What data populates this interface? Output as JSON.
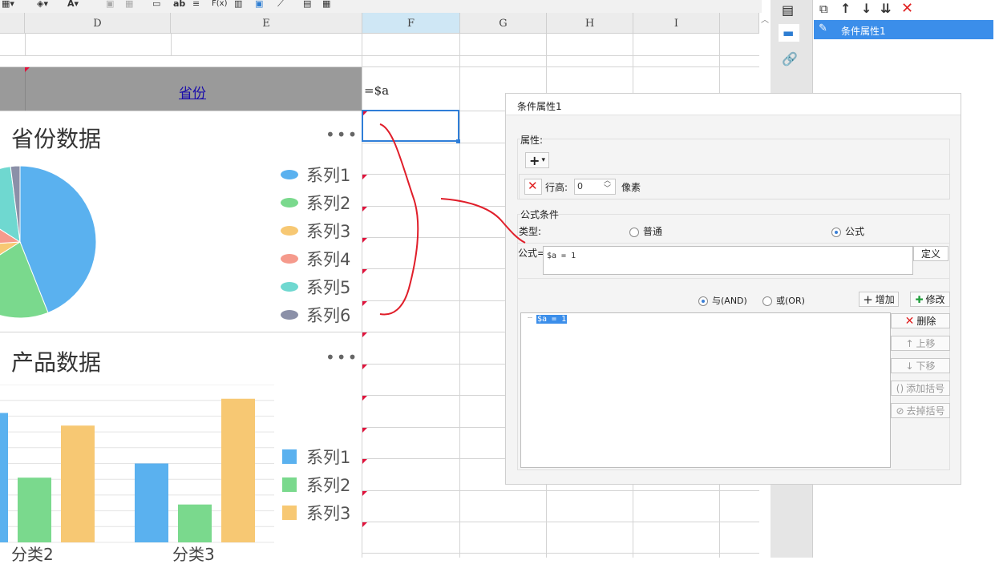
{
  "toolbar": {
    "text_style": "ab",
    "formula": "F(x)"
  },
  "columns": {
    "d": "D",
    "e": "E",
    "f": "F",
    "g": "G",
    "h": "H",
    "i": "I"
  },
  "cells": {
    "header_province": "省份",
    "formula_cell": "=$a"
  },
  "chart1": {
    "title": "省份数据",
    "more": "•••",
    "legend": [
      {
        "name": "系列1",
        "color": "#5ab1ef"
      },
      {
        "name": "系列2",
        "color": "#7ad98d"
      },
      {
        "name": "系列3",
        "color": "#f7c873"
      },
      {
        "name": "系列4",
        "color": "#f59a8c"
      },
      {
        "name": "系列5",
        "color": "#6fd8d0"
      },
      {
        "name": "系列6",
        "color": "#8b90a8"
      }
    ]
  },
  "chart2": {
    "title": "产品数据",
    "more": "•••",
    "axis_labels": [
      "分类2",
      "分类3"
    ],
    "legend": [
      {
        "name": "系列1",
        "color": "#5ab1ef"
      },
      {
        "name": "系列2",
        "color": "#7ad98d"
      },
      {
        "name": "系列3",
        "color": "#f7c873"
      }
    ]
  },
  "chart_data": [
    {
      "type": "pie",
      "title": "省份数据",
      "series": [
        {
          "name": "系列1",
          "value": 44
        },
        {
          "name": "系列2",
          "value": 22
        },
        {
          "name": "系列3",
          "value": 8
        },
        {
          "name": "系列4",
          "value": 10
        },
        {
          "name": "系列5",
          "value": 14
        },
        {
          "name": "系列6",
          "value": 2
        }
      ]
    },
    {
      "type": "bar",
      "title": "产品数据",
      "categories": [
        "分类2",
        "分类3"
      ],
      "series": [
        {
          "name": "系列1",
          "values": [
            82,
            50
          ]
        },
        {
          "name": "系列2",
          "values": [
            41,
            24
          ]
        },
        {
          "name": "系列3",
          "values": [
            74,
            91
          ]
        }
      ],
      "ylim": [
        0,
        100
      ]
    }
  ],
  "right_panel": {
    "item_label": "条件属性1"
  },
  "dialog": {
    "title": "条件属性1",
    "attr_label": "属性:",
    "add_symbol": "+",
    "row_height_label": "行高:",
    "row_height_value": "0",
    "unit": "像素",
    "formula_cond_label": "公式条件",
    "type_label": "类型:",
    "radio_normal": "普通",
    "radio_formula": "公式",
    "formula_label": "公式=",
    "formula_value": "$a = 1",
    "define_btn": "定义",
    "and_label": "与(AND)",
    "or_label": "或(OR)",
    "add_btn": "增加",
    "modify_btn": "修改",
    "list_item": "$a = 1",
    "delete_btn": "删除",
    "up_btn": "上移",
    "down_btn": "下移",
    "add_bracket_btn": "添加括号",
    "remove_bracket_btn": "去掉括号"
  }
}
